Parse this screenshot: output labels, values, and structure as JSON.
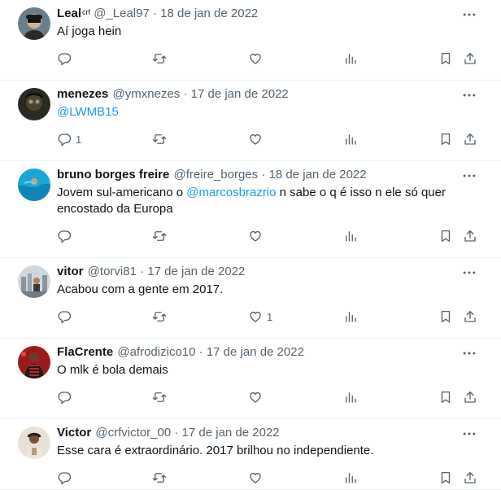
{
  "tweets": [
    {
      "name": "Leal",
      "badge": "crf",
      "handle": "@_Leal97",
      "date": "18 de jan de 2022",
      "parts": [
        {
          "t": "Aí joga hein",
          "m": false
        }
      ],
      "replies": "",
      "likes": ""
    },
    {
      "name": "menezes",
      "badge": "",
      "handle": "@ymxnezes",
      "date": "17 de jan de 2022",
      "parts": [
        {
          "t": "@LWMB15",
          "m": true
        }
      ],
      "replies": "1",
      "likes": ""
    },
    {
      "name": "bruno borges freire",
      "badge": "",
      "handle": "@freire_borges",
      "date": "18 de jan de 2022",
      "parts": [
        {
          "t": "Jovem sul-americano o ",
          "m": false
        },
        {
          "t": "@marcosbrazrio",
          "m": true
        },
        {
          "t": " n sabe o q é isso n ele só quer",
          "m": false
        },
        {
          "t": "\n",
          "m": false
        },
        {
          "t": "encostado da Europa",
          "m": false
        }
      ],
      "replies": "",
      "likes": ""
    },
    {
      "name": "vitor",
      "badge": "",
      "handle": "@torvi81",
      "date": "17 de jan de 2022",
      "parts": [
        {
          "t": "Acabou com a gente em 2017.",
          "m": false
        }
      ],
      "replies": "",
      "likes": "1"
    },
    {
      "name": "FlaCrente",
      "badge": "",
      "handle": "@afrodizico10",
      "date": "17 de jan de 2022",
      "parts": [
        {
          "t": "O mlk é bola demais",
          "m": false
        }
      ],
      "replies": "",
      "likes": ""
    },
    {
      "name": "Victor",
      "badge": "",
      "handle": "@crfvictor_00",
      "date": "17 de jan de 2022",
      "parts": [
        {
          "t": "Esse cara é extraordinário. 2017 brilhou no independiente.",
          "m": false
        }
      ],
      "replies": "",
      "likes": ""
    }
  ],
  "separator": "·",
  "colors": {
    "text": "#0f1419",
    "secondary": "#536471",
    "link": "#1d9bf0",
    "divider": "#eff3f4"
  },
  "icons": [
    "more-icon",
    "reply-icon",
    "retweet-icon",
    "like-icon",
    "views-icon",
    "bookmark-icon",
    "share-icon"
  ]
}
